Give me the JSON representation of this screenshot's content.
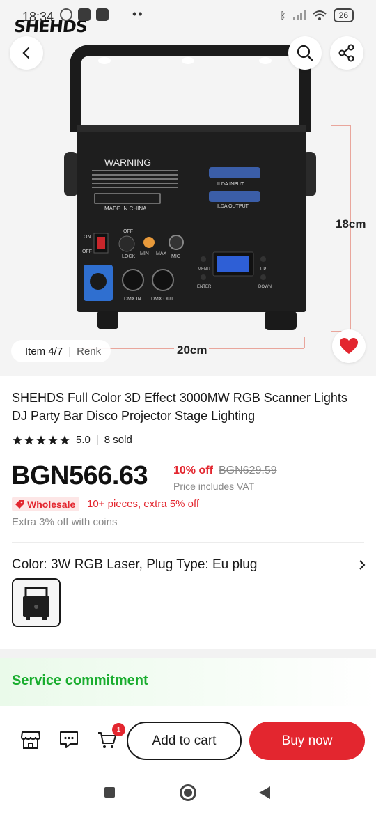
{
  "status_bar": {
    "time": "18:34",
    "battery": "26"
  },
  "brand": {
    "logo_text": "SHEHDS"
  },
  "gallery": {
    "item_counter": "Item 4/7",
    "ranking_label": "Renk",
    "photo_text": {
      "warning": "WARNING",
      "made_in": "MADE IN CHINA",
      "ilda_input": "ILDA INPUT",
      "ilda_output": "ILDA OUTPUT",
      "on": "ON",
      "off": "OFF",
      "lock": "LOCK",
      "min": "MIN",
      "max": "MAX",
      "mic": "MIC",
      "dmx_in": "DMX IN",
      "dmx_out": "DMX OUT",
      "menu": "MENU",
      "enter": "ENTER",
      "up": "UP",
      "down": "DOWN"
    },
    "dimension_height": "18cm",
    "dimension_width": "20cm"
  },
  "product": {
    "title": "SHEHDS Full Color 3D Effect 3000MW RGB Scanner Lights DJ Party Bar Disco Projector Stage Lighting",
    "rating": "5.0",
    "stars": 5,
    "sold": "8 sold",
    "price": "BGN566.63",
    "discount": "10% off",
    "original_price": "BGN629.59",
    "vat_note": "Price includes VAT",
    "wholesale_badge": "Wholesale",
    "wholesale_text": "10+ pieces, extra 5% off",
    "coins_text": "Extra 3% off with coins",
    "variant_label": "Color: 3W RGB Laser, Plug Type: Eu plug",
    "service_title": "Service commitment"
  },
  "bottom_bar": {
    "cart_count": "1",
    "add_to_cart": "Add to cart",
    "buy_now": "Buy now"
  },
  "colors": {
    "accent_red": "#e3262f",
    "service_green": "#1aad2f"
  }
}
